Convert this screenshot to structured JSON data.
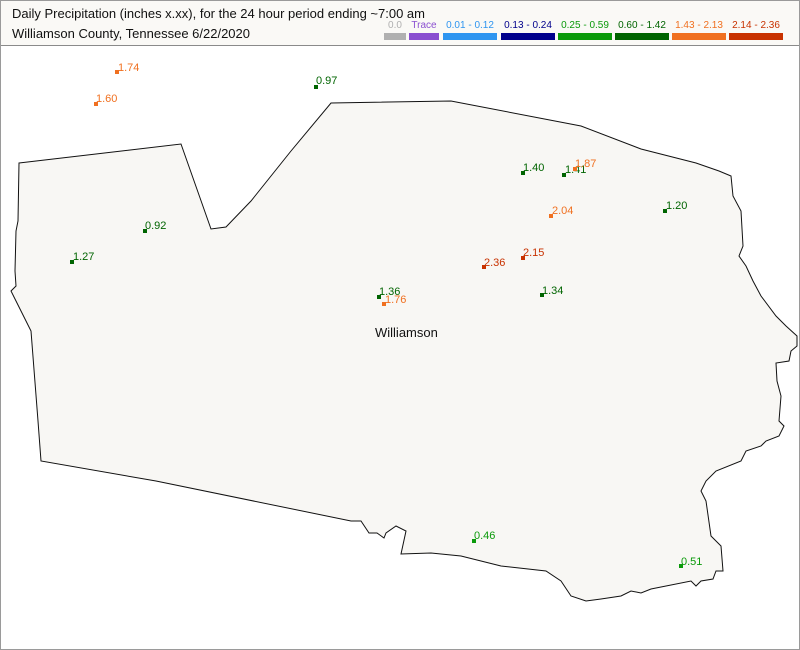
{
  "header": {
    "title_line1": "Daily Precipitation (inches  x.xx),  for the 24 hour period ending ~7:00 am",
    "title_line2": "Williamson County, Tennessee  6/22/2020"
  },
  "legend": [
    {
      "label": "0.0",
      "color": "#b0b0b0"
    },
    {
      "label": "Trace",
      "color": "#8a4fd0"
    },
    {
      "label": "0.01 - 0.12",
      "color": "#2e95f0"
    },
    {
      "label": "0.13 - 0.24",
      "color": "#00008c"
    },
    {
      "label": "0.25 - 0.59",
      "color": "#0a9a0a"
    },
    {
      "label": "0.60 - 1.42",
      "color": "#006400"
    },
    {
      "label": "1.43 - 2.13",
      "color": "#f07020"
    },
    {
      "label": "2.14 - 2.36",
      "color": "#c83200"
    }
  ],
  "map": {
    "county_name": "Williamson",
    "fill_color": "#f8f7f4",
    "outline_color": "#111111"
  },
  "stations": [
    {
      "value": "1.74",
      "color": "#f07020"
    },
    {
      "value": "1.60",
      "color": "#f07020"
    },
    {
      "value": "0.97",
      "color": "#006400"
    },
    {
      "value": "1.40",
      "color": "#006400"
    },
    {
      "value": "1.41",
      "color": "#006400"
    },
    {
      "value": "1.87",
      "color": "#f07020"
    },
    {
      "value": "2.04",
      "color": "#f07020"
    },
    {
      "value": "1.20",
      "color": "#006400"
    },
    {
      "value": "0.92",
      "color": "#006400"
    },
    {
      "value": "1.27",
      "color": "#006400"
    },
    {
      "value": "2.36",
      "color": "#c83200"
    },
    {
      "value": "2.15",
      "color": "#c83200"
    },
    {
      "value": "1.36",
      "color": "#006400"
    },
    {
      "value": "1.76",
      "color": "#f07020"
    },
    {
      "value": "1.34",
      "color": "#006400"
    },
    {
      "value": "0.46",
      "color": "#0a9a0a"
    },
    {
      "value": "0.51",
      "color": "#0a9a0a"
    }
  ]
}
